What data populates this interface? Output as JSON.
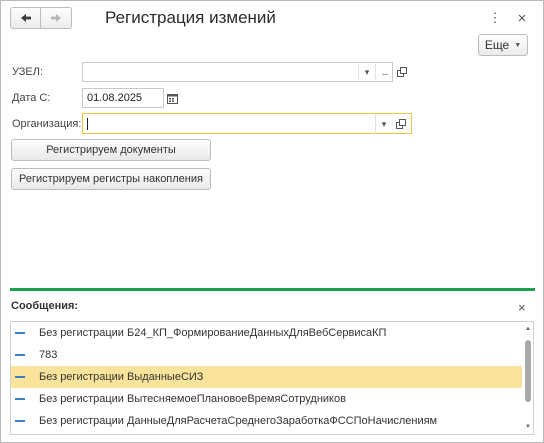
{
  "window": {
    "title": "Регистрация измений",
    "more_label": "Еще",
    "more_menu_icon": "⋮",
    "close_icon": "×"
  },
  "form": {
    "node": {
      "label": "УЗЕЛ:",
      "value": "",
      "dropdown_icon": "▾",
      "select_icon": "..."
    },
    "date": {
      "label": "Дата С:",
      "value": "01.08.2025"
    },
    "org": {
      "label": "Организация:",
      "value": "",
      "dropdown_icon": "▾"
    }
  },
  "buttons": {
    "register_docs": "Регистрируем документы",
    "register_registers": "Регистрируем регистры накопления"
  },
  "messages": {
    "title": "Сообщения:",
    "close_icon": "×",
    "items": [
      {
        "text": "Без регистрации Б24_КП_ФормированиеДанныхДляВебСервисаКП",
        "selected": false
      },
      {
        "text": "783",
        "selected": false
      },
      {
        "text": "Без регистрации ВыданныеСИЗ",
        "selected": true
      },
      {
        "text": "Без регистрации ВытесняемоеПлановоеВремяСотрудников",
        "selected": false
      },
      {
        "text": "Без регистрации ДанныеДляРасчетаСреднегоЗаработкаФССПоНачислениям",
        "selected": false
      }
    ]
  },
  "colors": {
    "accent_green": "#1f9e4d",
    "selection": "#fae39a",
    "focus_border": "#f1c448",
    "dash_blue": "#3c7fc5"
  }
}
